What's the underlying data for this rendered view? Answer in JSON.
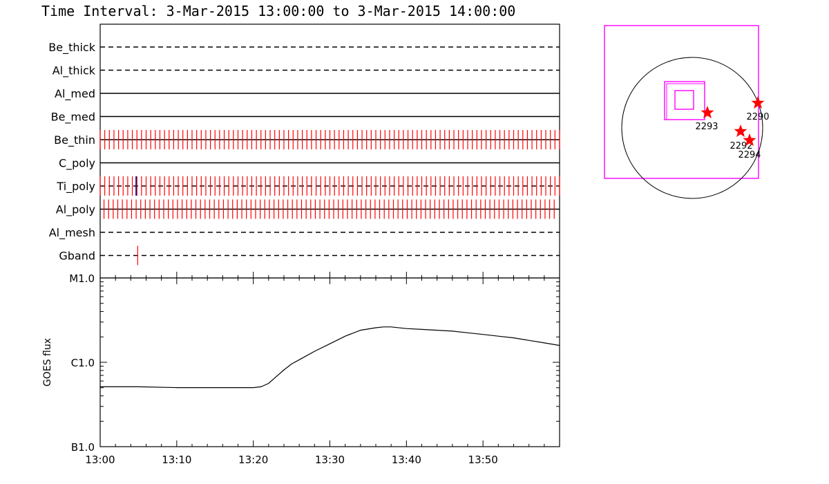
{
  "title": "Time Interval:  3-Mar-2015 13:00:00 to  3-Mar-2015 14:00:00",
  "colors": {
    "axis": "#000000",
    "marks": "#ff0000",
    "box": "#ff00ff",
    "star": "#ff0000"
  },
  "chart_data": [
    {
      "type": "event-timeline",
      "x_range_minutes": [
        0,
        60
      ],
      "channels": [
        {
          "name": "Be_thick",
          "style": "dashed",
          "marks": []
        },
        {
          "name": "Al_thick",
          "style": "dashed",
          "marks": []
        },
        {
          "name": "Al_med",
          "style": "solid",
          "marks": []
        },
        {
          "name": "Be_med",
          "style": "solid",
          "marks": []
        },
        {
          "name": "Be_thin",
          "style": "solid",
          "marks": "every 0.6 min from 0.0 to 60.0"
        },
        {
          "name": "C_poly",
          "style": "solid",
          "marks": []
        },
        {
          "name": "Ti_poly",
          "style": "dashed",
          "marks": "every 0.6 min from 0.0 to 60.0",
          "highlight_minute": 4.7
        },
        {
          "name": "Al_poly",
          "style": "solid",
          "marks": "every 0.6 min from 0.5 to 59.5"
        },
        {
          "name": "Al_mesh",
          "style": "dashed",
          "marks": []
        },
        {
          "name": "Gband",
          "style": "dashed",
          "marks": [
            4.9
          ]
        }
      ]
    },
    {
      "type": "line",
      "ylabel": "GOES flux",
      "y_scale": "log",
      "y_ticks": [
        "B1.0",
        "C1.0",
        "M1.0"
      ],
      "ylim_log": [
        -7,
        -5
      ],
      "x_tick_labels": [
        "13:00",
        "13:10",
        "13:20",
        "13:30",
        "13:40",
        "13:50"
      ],
      "x_ticks_minutes": [
        0,
        10,
        20,
        30,
        40,
        50
      ],
      "xlim_minutes": [
        0,
        60
      ],
      "series": [
        {
          "x_minutes": [
            0,
            5,
            10,
            13,
            16,
            20,
            21,
            22,
            23,
            24,
            25,
            26,
            28,
            30,
            32,
            34,
            36,
            37,
            38,
            40,
            42,
            44,
            46,
            48,
            50,
            52,
            54,
            56,
            58,
            60
          ],
          "log_flux": [
            -6.29,
            -6.29,
            -6.3,
            -6.3,
            -6.3,
            -6.3,
            -6.29,
            -6.25,
            -6.17,
            -6.09,
            -6.02,
            -5.97,
            -5.87,
            -5.78,
            -5.69,
            -5.62,
            -5.59,
            -5.58,
            -5.58,
            -5.6,
            -5.61,
            -5.62,
            -5.63,
            -5.65,
            -5.67,
            -5.69,
            -5.71,
            -5.74,
            -5.77,
            -5.8
          ]
        }
      ]
    }
  ],
  "context_map": {
    "active_regions": [
      {
        "label": "2293"
      },
      {
        "label": "2290"
      },
      {
        "label": "2292"
      },
      {
        "label": "2294"
      }
    ]
  }
}
